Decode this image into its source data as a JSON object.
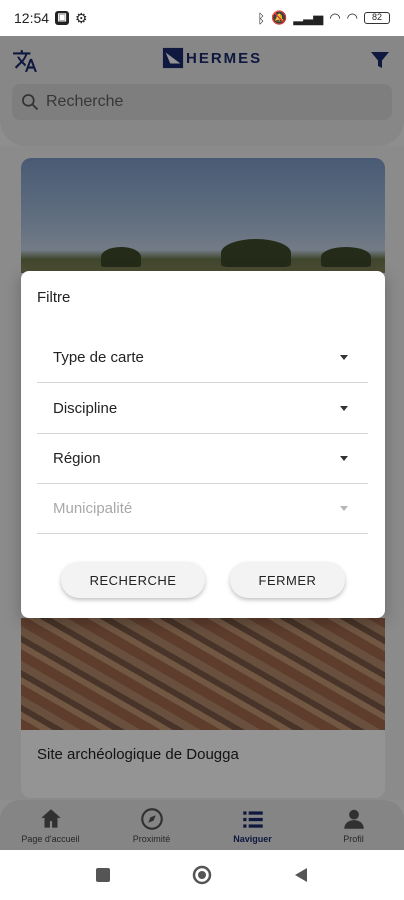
{
  "status_bar": {
    "time": "12:54",
    "battery": "82"
  },
  "header": {
    "logo_text": "HERMES"
  },
  "search": {
    "placeholder": "Recherche"
  },
  "card": {
    "title": "Site archéologique de Dougga"
  },
  "dialog": {
    "title": "Filtre",
    "dropdowns": [
      {
        "label": "Type de carte",
        "disabled": false
      },
      {
        "label": "Discipline",
        "disabled": false
      },
      {
        "label": "Région",
        "disabled": false
      },
      {
        "label": "Municipalité",
        "disabled": true
      }
    ],
    "search_button": "RECHERCHE",
    "close_button": "FERMER"
  },
  "bottom_nav": {
    "items": [
      {
        "label": "Page d'accueil",
        "icon": "home-icon"
      },
      {
        "label": "Proximité",
        "icon": "compass-icon"
      },
      {
        "label": "Naviguer",
        "icon": "list-icon",
        "active": true
      },
      {
        "label": "Profil",
        "icon": "person-icon"
      }
    ]
  },
  "colors": {
    "brand": "#1b2a6b",
    "overlay": "rgba(0,0,0,0.42)"
  }
}
